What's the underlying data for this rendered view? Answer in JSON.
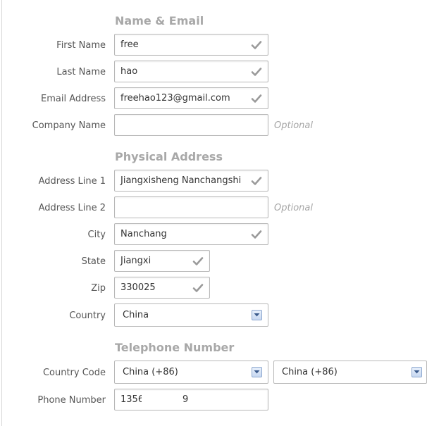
{
  "sections": {
    "name_email": "Name & Email",
    "physical_address": "Physical Address",
    "telephone": "Telephone Number"
  },
  "fields": {
    "first_name": {
      "label": "First Name",
      "value": "free"
    },
    "last_name": {
      "label": "Last Name",
      "value": "hao"
    },
    "email": {
      "label": "Email Address",
      "value": "freehao123@gmail.com"
    },
    "company": {
      "label": "Company Name",
      "value": "",
      "hint": "Optional"
    },
    "address1": {
      "label": "Address Line 1",
      "value": "Jiangxisheng Nanchangshi"
    },
    "address2": {
      "label": "Address Line 2",
      "value": "",
      "hint": "Optional"
    },
    "city": {
      "label": "City",
      "value": "Nanchang"
    },
    "state": {
      "label": "State",
      "value": "Jiangxi"
    },
    "zip": {
      "label": "Zip",
      "value": "330025"
    },
    "country": {
      "label": "Country",
      "value": "China"
    },
    "country_code": {
      "label": "Country Code",
      "value": "China (+86)",
      "value2": "China (+86)"
    },
    "phone": {
      "label": "Phone Number",
      "value": "1356",
      "value_suffix": "9"
    }
  },
  "icons": {
    "valid": "checkmark-icon",
    "dropdown": "chevron-down-icon"
  },
  "colors": {
    "section_title": "#a8a8a8",
    "check": "#9a9a9a",
    "hint": "#a6a6a6"
  }
}
